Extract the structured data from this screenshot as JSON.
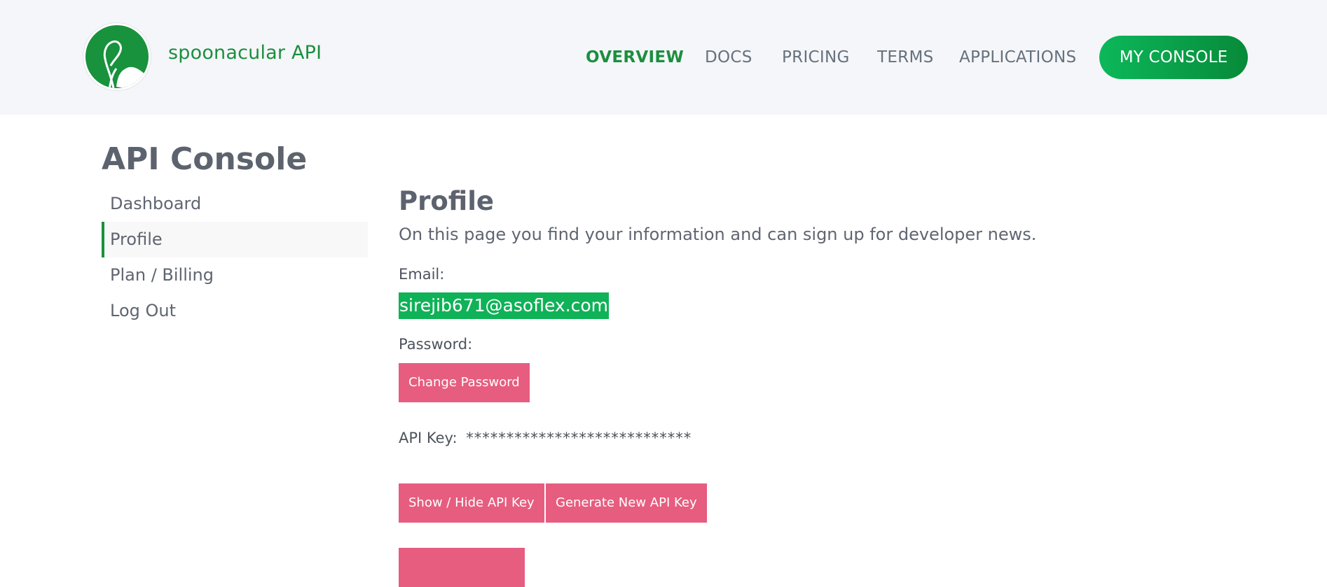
{
  "header": {
    "brand": "spoonacular API",
    "nav": [
      {
        "label": "OVERVIEW",
        "active": true
      },
      {
        "label": "DOCS",
        "active": false
      },
      {
        "label": "PRICING",
        "active": false
      },
      {
        "label": "TERMS",
        "active": false
      },
      {
        "label": "APPLICATIONS",
        "active": false
      }
    ],
    "console_button": "MY CONSOLE",
    "logo_icon": "spoon-leaf-logo-icon"
  },
  "page": {
    "title": "API Console"
  },
  "sidebar": {
    "items": [
      {
        "label": "Dashboard",
        "active": false
      },
      {
        "label": "Profile",
        "active": true
      },
      {
        "label": "Plan / Billing",
        "active": false
      },
      {
        "label": "Log Out",
        "active": false
      }
    ]
  },
  "main": {
    "title": "Profile",
    "description": "On this page you find your information and can sign up for developer news.",
    "email_label": "Email:",
    "email_value": "sirejib671@asoflex.com",
    "password_label": "Password:",
    "change_password_button": "Change Password",
    "api_key_label": "API Key:",
    "api_key_mask": "****************************",
    "show_hide_button": "Show / Hide API Key",
    "generate_button": "Generate New API Key"
  },
  "colors": {
    "brand_green": "#1b8f3f",
    "button_pink": "#e65d7f",
    "highlight_green": "#0fb257"
  }
}
